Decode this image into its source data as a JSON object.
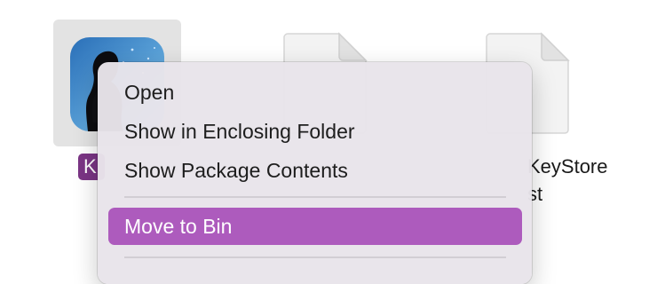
{
  "desktop": {
    "app_icon_name": "app-silhouette-icon",
    "app_label_visible": "K",
    "file_icon_name": "document-icon",
    "file_label_line1": "KeyStore",
    "file_label_line2": "st"
  },
  "context_menu": {
    "items": [
      {
        "label": "Open"
      },
      {
        "label": "Show in Enclosing Folder"
      },
      {
        "label": "Show Package Contents"
      },
      {
        "label": "Move to Bin",
        "highlighted": true
      }
    ]
  },
  "colors": {
    "selection_highlight": "#ad5bbd",
    "label_highlight": "#7b3585",
    "menu_background": "#e8e4ea",
    "tile_background": "#e3e3e3"
  }
}
